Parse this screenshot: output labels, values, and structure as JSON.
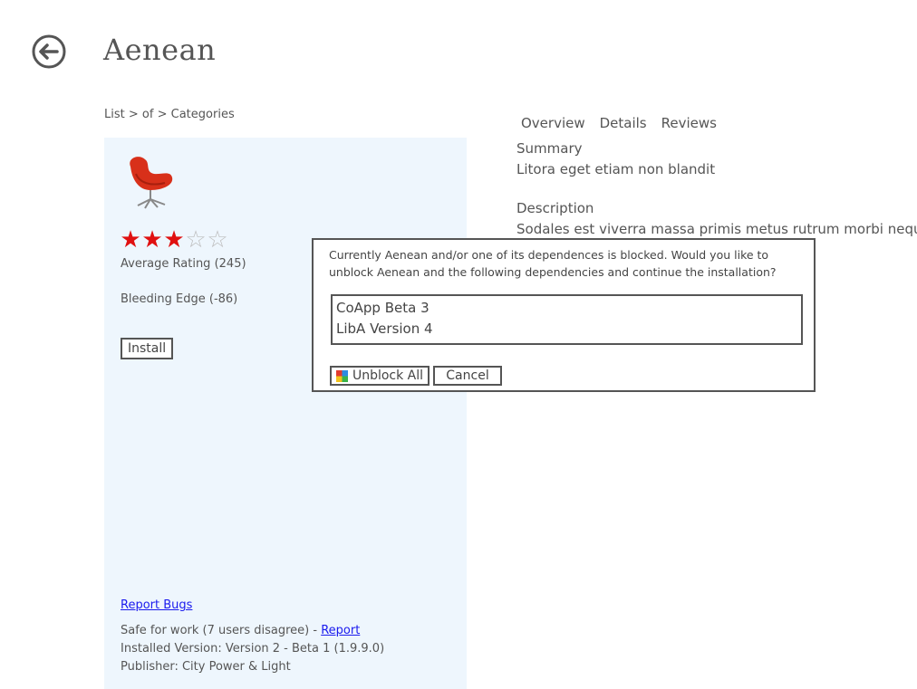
{
  "header": {
    "back_icon": "back-arrow-circle-icon",
    "title": "Aenean"
  },
  "breadcrumb": [
    "List",
    "of",
    "Categories"
  ],
  "breadcrumb_separator": ">",
  "product": {
    "image_icon": "red-chair-image",
    "rating": {
      "value": 3,
      "max": 5,
      "filled_color": "#e01010",
      "empty_color": "#bdbdbd"
    },
    "avg_label": "Average Rating",
    "avg_count": "(245)",
    "bleeding_label": "Bleeding Edge",
    "bleeding_value": "(-86)",
    "install_label": "Install"
  },
  "footer": {
    "report_bugs": "Report Bugs",
    "safe_text": "Safe for work (7 users disagree) - ",
    "report_link": "Report",
    "installed": "Installed Version: Version 2 - Beta 1 (1.9.9.0)",
    "publisher": "Publisher: City Power & Light"
  },
  "tabs": [
    "Overview",
    "Details",
    "Reviews"
  ],
  "summary": {
    "heading": "Summary",
    "text": "Litora eget etiam non blandit"
  },
  "description": {
    "heading": "Description",
    "text": "Sodales est viverra massa primis metus rutrum morbi neque"
  },
  "dialog": {
    "message": "Currently Aenean and/or one of its dependences is blocked. Would you like to unblock Aenean and the following dependencies and continue the installation?",
    "dependencies": [
      "CoApp Beta 3",
      "LibA Version 4"
    ],
    "unblock_label": "Unblock All",
    "unblock_icon": "shield-icon",
    "cancel_label": "Cancel"
  },
  "colors": {
    "panel_bg": "#eef6fd",
    "link": "#1a1aee",
    "text": "#555555"
  }
}
